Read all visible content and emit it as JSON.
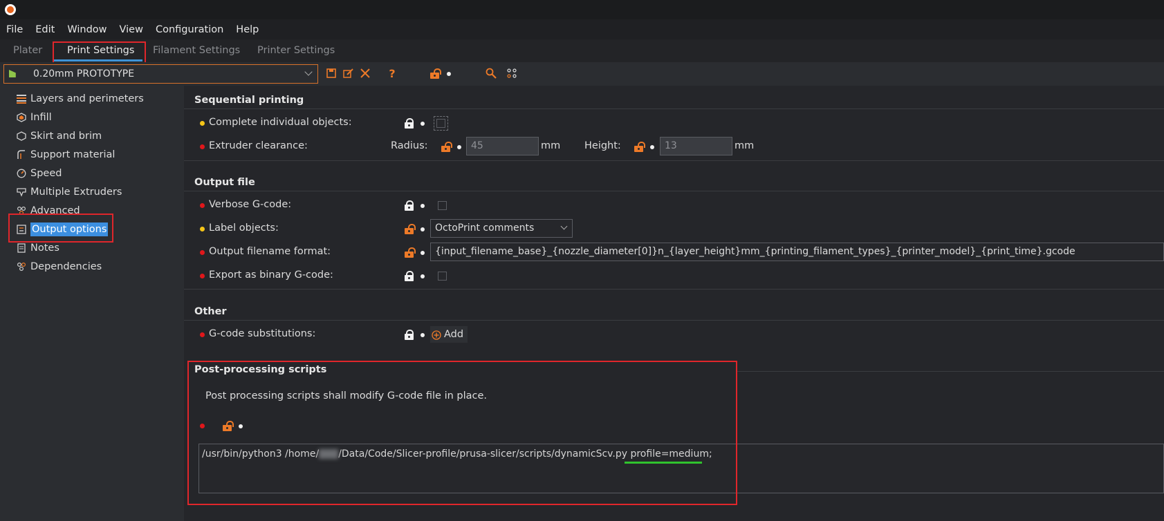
{
  "menu": [
    "File",
    "Edit",
    "Window",
    "View",
    "Configuration",
    "Help"
  ],
  "tabs": {
    "plater": "Plater",
    "print_settings": "Print Settings",
    "filament_settings": "Filament Settings",
    "printer_settings": "Printer Settings"
  },
  "preset": {
    "name": "0.20mm PROTOTYPE"
  },
  "sidebar": {
    "items": [
      {
        "label": "Layers and perimeters"
      },
      {
        "label": "Infill"
      },
      {
        "label": "Skirt and brim"
      },
      {
        "label": "Support material"
      },
      {
        "label": "Speed"
      },
      {
        "label": "Multiple Extruders"
      },
      {
        "label": "Advanced"
      },
      {
        "label": "Output options"
      },
      {
        "label": "Notes"
      },
      {
        "label": "Dependencies"
      }
    ]
  },
  "sequential": {
    "title": "Sequential printing",
    "complete_label": "Complete individual objects:",
    "clearance_label": "Extruder clearance:",
    "radius_label": "Radius:",
    "radius_value": "45",
    "radius_unit": "mm",
    "height_label": "Height:",
    "height_value": "13",
    "height_unit": "mm"
  },
  "output_file": {
    "title": "Output file",
    "verbose_label": "Verbose G-code:",
    "label_objects_label": "Label objects:",
    "label_objects_value": "OctoPrint comments",
    "filename_label": "Output filename format:",
    "filename_value": "{input_filename_base}_{nozzle_diameter[0]}n_{layer_height}mm_{printing_filament_types}_{printer_model}_{print_time}.gcode",
    "binary_label": "Export as binary G-code:"
  },
  "other": {
    "title": "Other",
    "substitutions_label": "G-code substitutions:",
    "add_label": "Add"
  },
  "post_processing": {
    "title": "Post-processing scripts",
    "note": "Post processing scripts shall modify G-code file in place.",
    "script_prefix": "/usr/bin/python3 /home/",
    "script_suffix": "/Data/Code/Slicer-profile/prusa-slicer/scripts/dynamicScv.py",
    "script_arg": "profile=medium;"
  },
  "colors": {
    "accent": "#3e94d8",
    "highlight_box": "#e0262b",
    "lock_open": "#ed7a28",
    "underline": "#30c32e"
  }
}
